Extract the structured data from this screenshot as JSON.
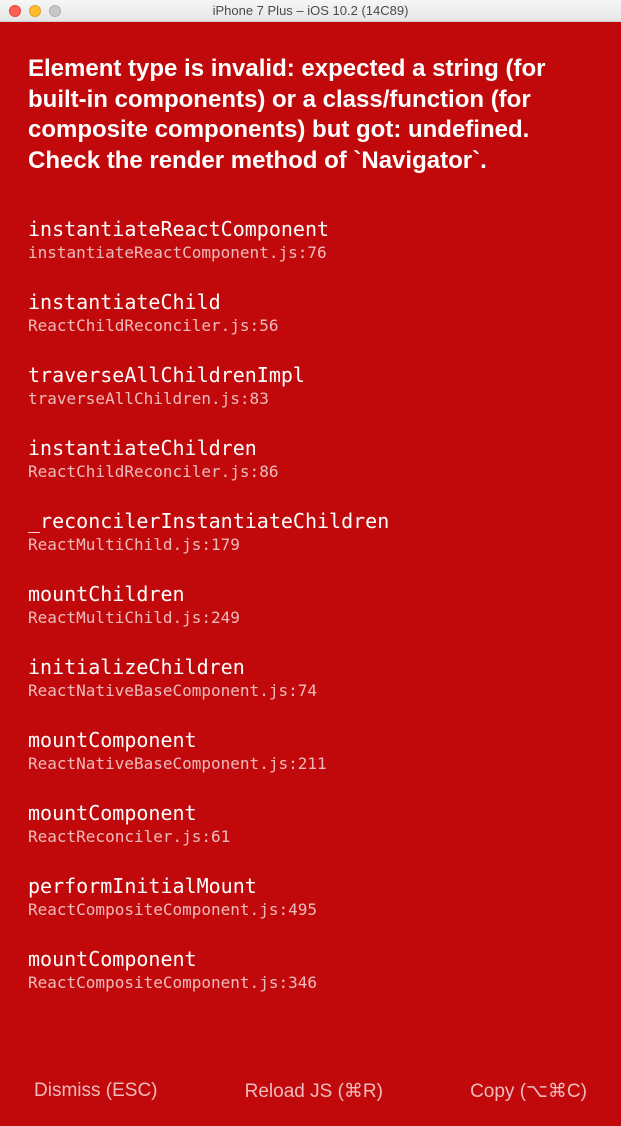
{
  "window": {
    "title": "iPhone 7 Plus – iOS 10.2 (14C89)"
  },
  "error": {
    "message": "Element type is invalid: expected a string (for built-in components) or a class/function (for composite components) but got: undefined. Check the render method of `Navigator`."
  },
  "stack": [
    {
      "fn": "instantiateReactComponent",
      "loc": "instantiateReactComponent.js:76"
    },
    {
      "fn": "instantiateChild",
      "loc": "ReactChildReconciler.js:56"
    },
    {
      "fn": "traverseAllChildrenImpl",
      "loc": "traverseAllChildren.js:83"
    },
    {
      "fn": "instantiateChildren",
      "loc": "ReactChildReconciler.js:86"
    },
    {
      "fn": "_reconcilerInstantiateChildren",
      "loc": "ReactMultiChild.js:179"
    },
    {
      "fn": "mountChildren",
      "loc": "ReactMultiChild.js:249"
    },
    {
      "fn": "initializeChildren",
      "loc": "ReactNativeBaseComponent.js:74"
    },
    {
      "fn": "mountComponent",
      "loc": "ReactNativeBaseComponent.js:211"
    },
    {
      "fn": "mountComponent",
      "loc": "ReactReconciler.js:61"
    },
    {
      "fn": "performInitialMount",
      "loc": "ReactCompositeComponent.js:495"
    },
    {
      "fn": "mountComponent",
      "loc": "ReactCompositeComponent.js:346"
    }
  ],
  "footer": {
    "dismiss": "Dismiss (ESC)",
    "reload": "Reload JS (⌘R)",
    "copy": "Copy (⌥⌘C)"
  }
}
